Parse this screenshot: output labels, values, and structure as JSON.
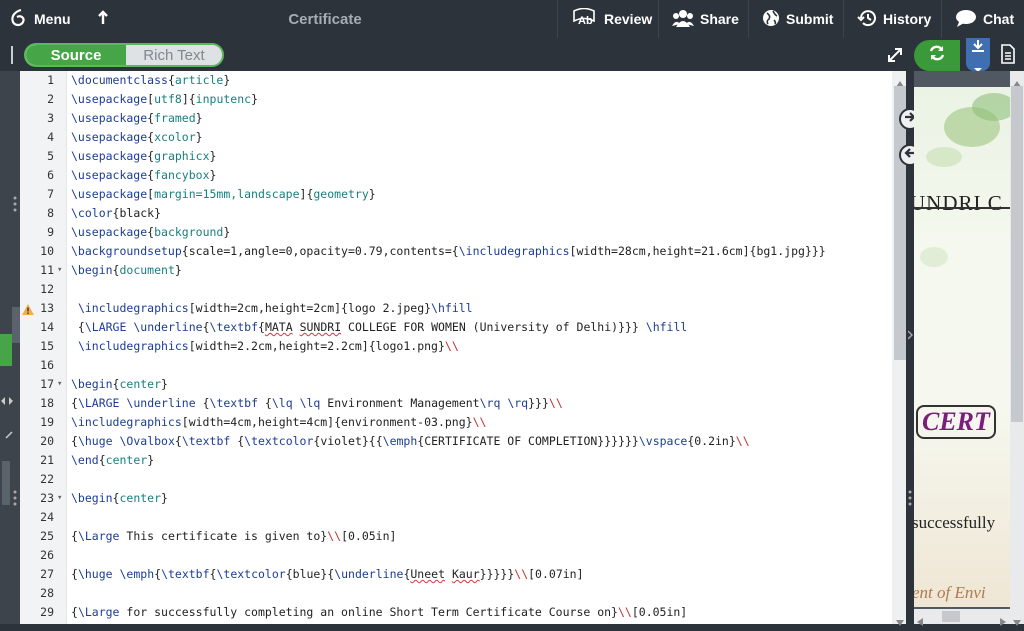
{
  "topbar": {
    "menu_label": "Menu",
    "title": "Certificate",
    "review_label": "Review",
    "share_label": "Share",
    "submit_label": "Submit",
    "history_label": "History",
    "chat_label": "Chat"
  },
  "editor_toggle": {
    "source_label": "Source",
    "rich_label": "Rich Text"
  },
  "preview": {
    "snippet_1": "UNDRI C",
    "snippet_2": "CERT",
    "snippet_3": "successfully",
    "snippet_4": "ent of Envi"
  },
  "colors": {
    "accent_green": "#46a546",
    "topbar_bg": "#2c333b",
    "command_blue": "#1c3d97",
    "arg_teal": "#1a7e7e"
  },
  "lines": [
    {
      "n": "1",
      "segs": [
        [
          "cmd",
          "\\documentclass"
        ],
        [
          "txt",
          "{"
        ],
        [
          "arg",
          "article"
        ],
        [
          "txt",
          "}"
        ]
      ]
    },
    {
      "n": "2",
      "segs": [
        [
          "cmd",
          "\\usepackage"
        ],
        [
          "txt",
          "["
        ],
        [
          "arg",
          "utf8"
        ],
        [
          "txt",
          "]{"
        ],
        [
          "arg",
          "inputenc"
        ],
        [
          "txt",
          "}"
        ]
      ]
    },
    {
      "n": "3",
      "segs": [
        [
          "cmd",
          "\\usepackage"
        ],
        [
          "txt",
          "{"
        ],
        [
          "arg",
          "framed"
        ],
        [
          "txt",
          "}"
        ]
      ]
    },
    {
      "n": "4",
      "segs": [
        [
          "cmd",
          "\\usepackage"
        ],
        [
          "txt",
          "{"
        ],
        [
          "arg",
          "xcolor"
        ],
        [
          "txt",
          "}"
        ]
      ]
    },
    {
      "n": "5",
      "segs": [
        [
          "cmd",
          "\\usepackage"
        ],
        [
          "txt",
          "{"
        ],
        [
          "arg",
          "graphicx"
        ],
        [
          "txt",
          "}"
        ]
      ]
    },
    {
      "n": "6",
      "segs": [
        [
          "cmd",
          "\\usepackage"
        ],
        [
          "txt",
          "{"
        ],
        [
          "arg",
          "fancybox"
        ],
        [
          "txt",
          "}"
        ]
      ]
    },
    {
      "n": "7",
      "segs": [
        [
          "cmd",
          "\\usepackage"
        ],
        [
          "txt",
          "["
        ],
        [
          "arg",
          "margin=15mm,landscape"
        ],
        [
          "txt",
          "]{"
        ],
        [
          "arg",
          "geometry"
        ],
        [
          "txt",
          "}"
        ]
      ]
    },
    {
      "n": "8",
      "segs": [
        [
          "cmd",
          "\\color"
        ],
        [
          "txt",
          "{black}"
        ]
      ]
    },
    {
      "n": "9",
      "segs": [
        [
          "cmd",
          "\\usepackage"
        ],
        [
          "txt",
          "{"
        ],
        [
          "arg",
          "background"
        ],
        [
          "txt",
          "}"
        ]
      ]
    },
    {
      "n": "10",
      "segs": [
        [
          "cmd",
          "\\backgroundsetup"
        ],
        [
          "txt",
          "{scale=1,angle=0,opacity=0.79,contents={"
        ],
        [
          "cmd",
          "\\includegraphics"
        ],
        [
          "txt",
          "[width=28cm,height=21.6cm]{bg1.jpg}}}"
        ]
      ]
    },
    {
      "n": "11",
      "fold": "▾",
      "segs": [
        [
          "cmd",
          "\\begin"
        ],
        [
          "txt",
          "{"
        ],
        [
          "arg",
          "document"
        ],
        [
          "txt",
          "}"
        ]
      ]
    },
    {
      "n": "12",
      "segs": []
    },
    {
      "n": "13",
      "warn": true,
      "segs": [
        [
          "txt",
          " "
        ],
        [
          "cmd",
          "\\includegraphics"
        ],
        [
          "txt",
          "[width=2cm,height=2cm]{logo 2.jpeg}"
        ],
        [
          "cmd",
          "\\hfill"
        ]
      ]
    },
    {
      "n": "14",
      "segs": [
        [
          "txt",
          " {"
        ],
        [
          "cmd",
          "\\LARGE"
        ],
        [
          "txt",
          " "
        ],
        [
          "cmd",
          "\\underline"
        ],
        [
          "txt",
          "{"
        ],
        [
          "cmd",
          "\\textbf"
        ],
        [
          "txt",
          "{"
        ],
        [
          "sq",
          "MATA"
        ],
        [
          "txt",
          " "
        ],
        [
          "sq",
          "SUNDRI"
        ],
        [
          "txt",
          " COLLEGE FOR WOMEN (University of Delhi)}}} "
        ],
        [
          "cmd",
          "\\hfill"
        ]
      ]
    },
    {
      "n": "15",
      "segs": [
        [
          "txt",
          " "
        ],
        [
          "cmd",
          "\\includegraphics"
        ],
        [
          "txt",
          "[width=2.2cm,height=2.2cm]{logo1.png}"
        ],
        [
          "red",
          "\\\\"
        ]
      ]
    },
    {
      "n": "16",
      "segs": []
    },
    {
      "n": "17",
      "fold": "▾",
      "segs": [
        [
          "cmd",
          "\\begin"
        ],
        [
          "txt",
          "{"
        ],
        [
          "arg",
          "center"
        ],
        [
          "txt",
          "}"
        ]
      ]
    },
    {
      "n": "18",
      "segs": [
        [
          "txt",
          "{"
        ],
        [
          "cmd",
          "\\LARGE"
        ],
        [
          "txt",
          " "
        ],
        [
          "cmd",
          "\\underline"
        ],
        [
          "txt",
          " {"
        ],
        [
          "cmd",
          "\\textbf"
        ],
        [
          "txt",
          " {"
        ],
        [
          "cmd",
          "\\lq"
        ],
        [
          "txt",
          " "
        ],
        [
          "cmd",
          "\\lq"
        ],
        [
          "txt",
          " Environment Management"
        ],
        [
          "cmd",
          "\\rq"
        ],
        [
          "txt",
          " "
        ],
        [
          "cmd",
          "\\rq"
        ],
        [
          "txt",
          "}}}"
        ],
        [
          "red",
          "\\\\"
        ]
      ]
    },
    {
      "n": "19",
      "segs": [
        [
          "cmd",
          "\\includegraphics"
        ],
        [
          "txt",
          "[width=4cm,height=4cm]{environment-03.png}"
        ],
        [
          "red",
          "\\\\"
        ]
      ]
    },
    {
      "n": "20",
      "segs": [
        [
          "txt",
          "{"
        ],
        [
          "cmd",
          "\\huge"
        ],
        [
          "txt",
          " "
        ],
        [
          "cmd",
          "\\Ovalbox"
        ],
        [
          "txt",
          "{"
        ],
        [
          "cmd",
          "\\textbf"
        ],
        [
          "txt",
          " {"
        ],
        [
          "cmd",
          "\\textcolor"
        ],
        [
          "txt",
          "{violet}{{"
        ],
        [
          "cmd",
          "\\emph"
        ],
        [
          "txt",
          "{CERTIFICATE OF COMPLETION}}}}}}"
        ],
        [
          "cmd",
          "\\vspace"
        ],
        [
          "txt",
          "{0.2in}"
        ],
        [
          "red",
          "\\\\"
        ]
      ]
    },
    {
      "n": "21",
      "segs": [
        [
          "cmd",
          "\\end"
        ],
        [
          "txt",
          "{"
        ],
        [
          "arg",
          "center"
        ],
        [
          "txt",
          "}"
        ]
      ]
    },
    {
      "n": "22",
      "segs": []
    },
    {
      "n": "23",
      "fold": "▾",
      "segs": [
        [
          "cmd",
          "\\begin"
        ],
        [
          "txt",
          "{"
        ],
        [
          "arg",
          "center"
        ],
        [
          "txt",
          "}"
        ]
      ]
    },
    {
      "n": "24",
      "segs": []
    },
    {
      "n": "25",
      "segs": [
        [
          "txt",
          "{"
        ],
        [
          "cmd",
          "\\Large"
        ],
        [
          "txt",
          " This certificate is given to}"
        ],
        [
          "red",
          "\\\\"
        ],
        [
          "txt",
          "[0.05in]"
        ]
      ]
    },
    {
      "n": "26",
      "segs": []
    },
    {
      "n": "27",
      "segs": [
        [
          "txt",
          "{"
        ],
        [
          "cmd",
          "\\huge"
        ],
        [
          "txt",
          " "
        ],
        [
          "cmd",
          "\\emph"
        ],
        [
          "txt",
          "{"
        ],
        [
          "cmd",
          "\\textbf"
        ],
        [
          "txt",
          "{"
        ],
        [
          "cmd",
          "\\textcolor"
        ],
        [
          "txt",
          "{blue}{"
        ],
        [
          "cmd",
          "\\underline"
        ],
        [
          "txt",
          "{"
        ],
        [
          "sq",
          "Uneet"
        ],
        [
          "txt",
          " "
        ],
        [
          "sq",
          "Kaur"
        ],
        [
          "txt",
          "}}}}}"
        ],
        [
          "red",
          "\\\\"
        ],
        [
          "txt",
          "[0.07in]"
        ]
      ]
    },
    {
      "n": "28",
      "segs": []
    },
    {
      "n": "29",
      "segs": [
        [
          "txt",
          "{"
        ],
        [
          "cmd",
          "\\Large"
        ],
        [
          "txt",
          " for successfully completing an online Short Term Certificate Course on}"
        ],
        [
          "red",
          "\\\\"
        ],
        [
          "txt",
          "[0.05in]"
        ]
      ]
    }
  ]
}
